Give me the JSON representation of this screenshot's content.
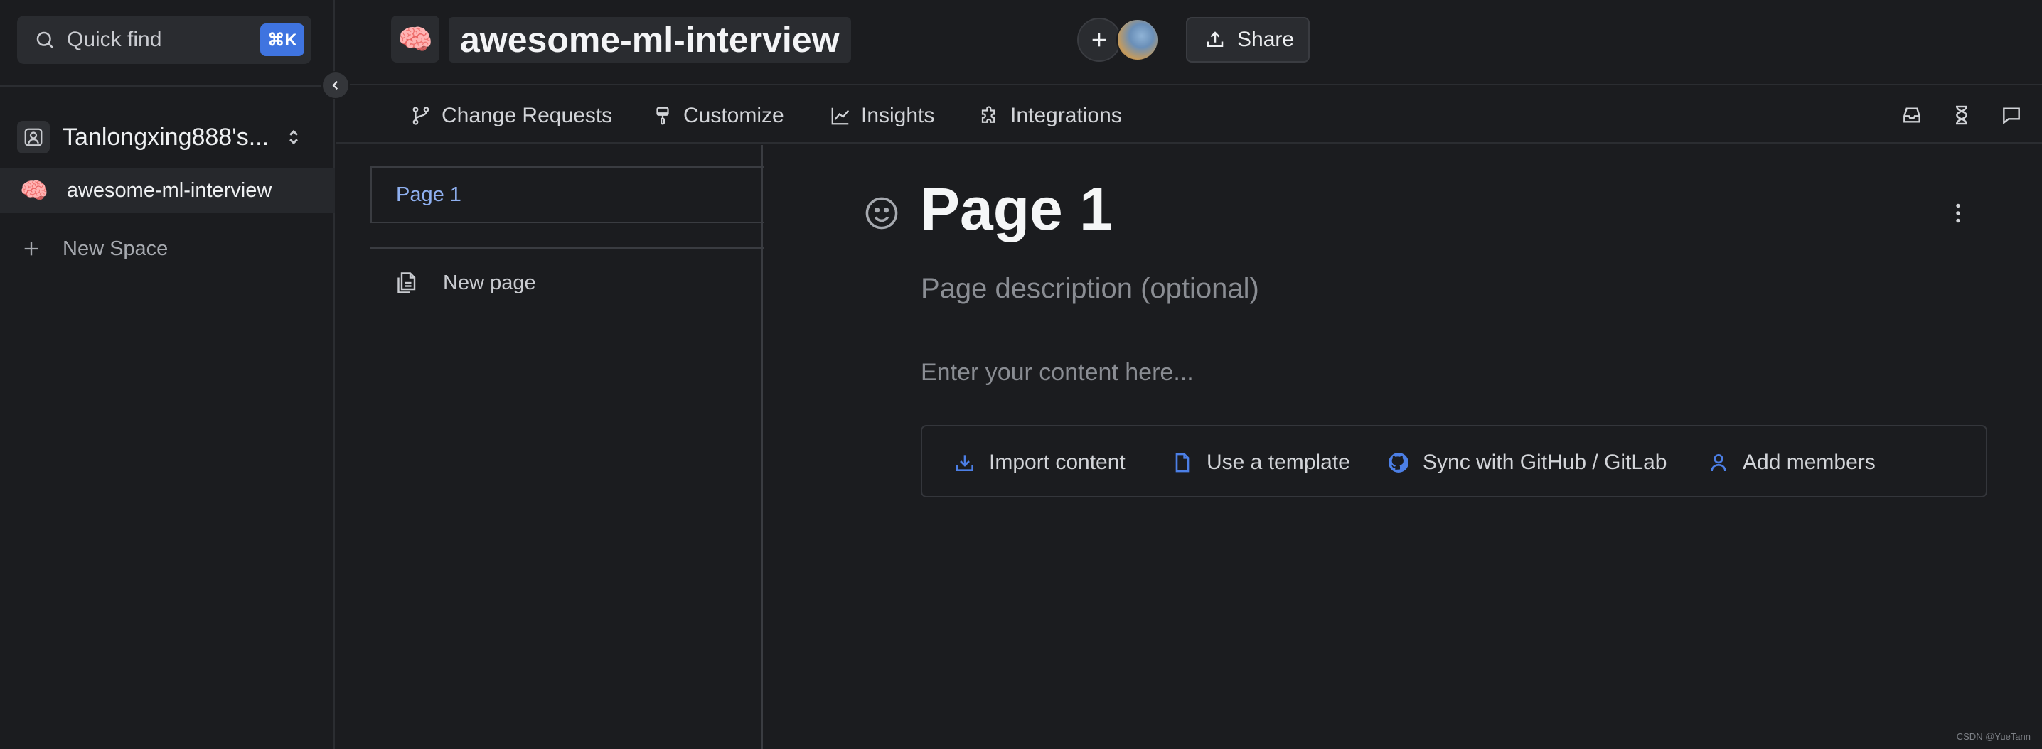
{
  "sidebar": {
    "quick_find": {
      "label": "Quick find",
      "shortcut": "⌘K"
    },
    "org": {
      "name": "Tanlongxing888's..."
    },
    "spaces": [
      {
        "emoji": "🧠",
        "label": "awesome-ml-interview"
      }
    ],
    "new_space_label": "New Space"
  },
  "header": {
    "emoji": "🧠",
    "title": "awesome-ml-interview",
    "share_label": "Share"
  },
  "tabs": [
    {
      "label": "Change Requests",
      "icon": "branch-icon"
    },
    {
      "label": "Customize",
      "icon": "brush-icon"
    },
    {
      "label": "Insights",
      "icon": "chart-icon"
    },
    {
      "label": "Integrations",
      "icon": "puzzle-icon"
    }
  ],
  "page_tree": {
    "pages": [
      {
        "label": "Page 1"
      }
    ],
    "new_page_label": "New page"
  },
  "main": {
    "title": "Page 1",
    "description_placeholder": "Page description (optional)",
    "content_placeholder": "Enter your content here...",
    "actions": [
      {
        "label": "Import content",
        "icon": "download-icon"
      },
      {
        "label": "Use a template",
        "icon": "document-icon"
      },
      {
        "label": "Sync with GitHub / GitLab",
        "icon": "github-icon"
      },
      {
        "label": "Add members",
        "icon": "user-icon"
      }
    ]
  },
  "watermark": "CSDN @YueTann",
  "colors": {
    "accent": "#3f74e0",
    "background": "#1b1c1f",
    "link": "#8fb0f0"
  }
}
